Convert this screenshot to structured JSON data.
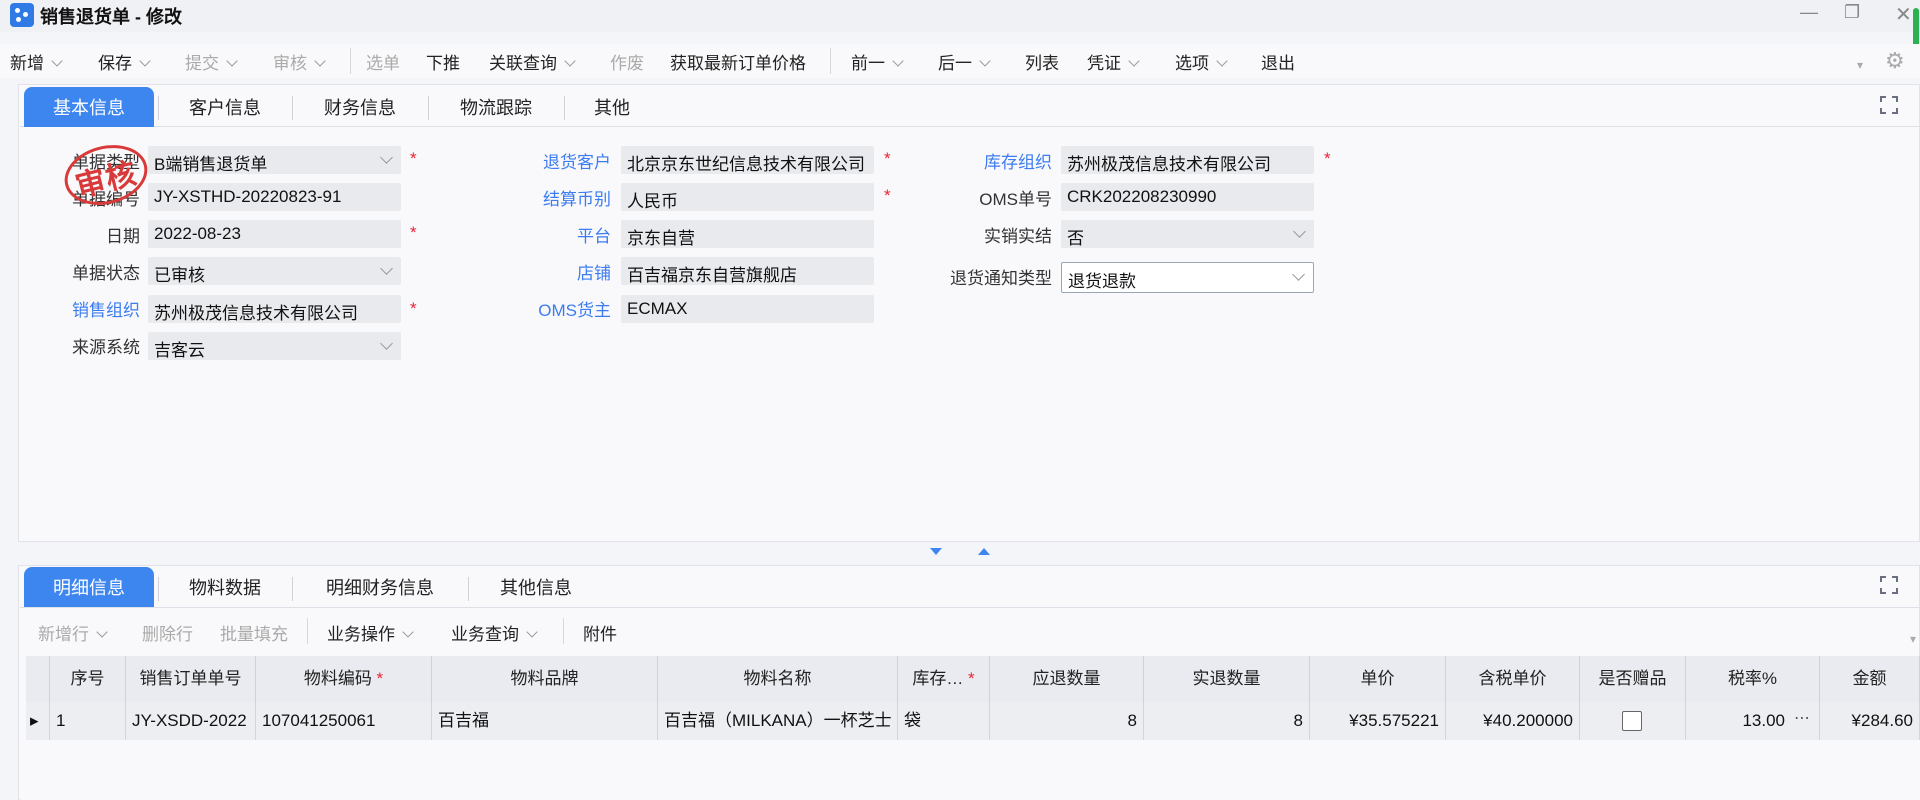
{
  "window": {
    "title": "销售退货单 - 修改"
  },
  "toolbar": {
    "new": "新增",
    "save": "保存",
    "submit": "提交",
    "audit": "审核",
    "select_bill": "选单",
    "push_down": "下推",
    "related_query": "关联查询",
    "void": "作废",
    "get_latest_price": "获取最新订单价格",
    "prev": "前一",
    "next": "后一",
    "list": "列表",
    "voucher": "凭证",
    "options": "选项",
    "exit": "退出"
  },
  "header_tabs": [
    "基本信息",
    "客户信息",
    "财务信息",
    "物流跟踪",
    "其他"
  ],
  "stamp_text": "审核",
  "form": {
    "bill_type": {
      "label": "单据类型",
      "value": "B端销售退货单"
    },
    "bill_no": {
      "label": "单据编号",
      "value": "JY-XSTHD-20220823-91"
    },
    "date": {
      "label": "日期",
      "value": "2022-08-23"
    },
    "bill_status": {
      "label": "单据状态",
      "value": "已审核"
    },
    "sales_org": {
      "label": "销售组织",
      "value": "苏州极茂信息技术有限公司"
    },
    "source_system": {
      "label": "来源系统",
      "value": "吉客云"
    },
    "return_customer": {
      "label": "退货客户",
      "value": "北京京东世纪信息技术有限公司"
    },
    "settle_currency": {
      "label": "结算币别",
      "value": "人民币"
    },
    "platform": {
      "label": "平台",
      "value": "京东自营"
    },
    "store": {
      "label": "店铺",
      "value": "百吉福京东自营旗舰店"
    },
    "oms_owner": {
      "label": "OMS货主",
      "value": "ECMAX"
    },
    "stock_org": {
      "label": "库存组织",
      "value": "苏州极茂信息技术有限公司"
    },
    "oms_no": {
      "label": "OMS单号",
      "value": "CRK202208230990"
    },
    "actual_settle": {
      "label": "实销实结",
      "value": "否"
    },
    "return_notice_type": {
      "label": "退货通知类型",
      "value": "退货退款"
    }
  },
  "detail_tabs": [
    "明细信息",
    "物料数据",
    "明细财务信息",
    "其他信息"
  ],
  "grid_toolbar": {
    "add_row": "新增行",
    "delete_row": "删除行",
    "batch_fill": "批量填充",
    "business_ops": "业务操作",
    "business_query": "业务查询",
    "attachment": "附件"
  },
  "table": {
    "columns": [
      "序号",
      "销售订单单号",
      "物料编码",
      "物料品牌",
      "物料名称",
      "库存…",
      "应退数量",
      "实退数量",
      "单价",
      "含税单价",
      "是否赠品",
      "税率%",
      "金额"
    ],
    "rows": [
      {
        "seq": "1",
        "order_no": "JY-XSDD-2022",
        "material_code": "107041250061",
        "brand": "百吉福",
        "material_name": "百吉福（MILKANA）一杯芝士",
        "stock_unit": "袋",
        "due_qty": "8",
        "actual_qty": "8",
        "unit_price": "¥35.575221",
        "tax_price": "¥40.200000",
        "is_gift": false,
        "tax_rate": "13.00",
        "amount": "¥284.60"
      }
    ]
  }
}
